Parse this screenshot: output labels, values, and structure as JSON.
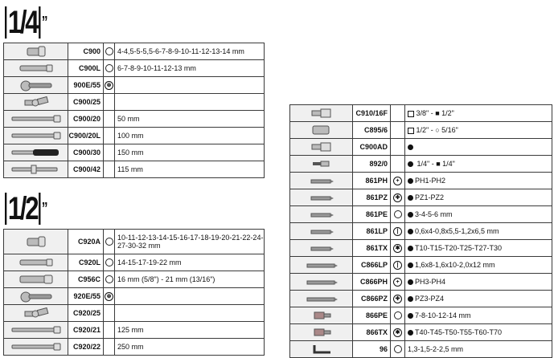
{
  "heading_quarter": {
    "main": "1/4",
    "mark": "”"
  },
  "heading_half": {
    "main": "1/2",
    "mark": "”"
  },
  "table_quarter": [
    {
      "code": "C900",
      "sym": "hex-outline",
      "desc": "4-4,5-5-5,5-6-7-8-9-10-11-12-13-14 mm",
      "icon": "socket-icon"
    },
    {
      "code": "C900L",
      "sym": "hex-outline",
      "desc": "6-7-8-9-10-11-12-13 mm",
      "icon": "deep-socket-icon"
    },
    {
      "code": "900E/55",
      "sym": "ratchet-symbol",
      "desc": "",
      "icon": "ratchet-icon"
    },
    {
      "code": "C900/25",
      "sym": "",
      "desc": "",
      "icon": "universal-joint-icon"
    },
    {
      "code": "C900/20",
      "sym": "",
      "desc": "50 mm",
      "icon": "extension-icon"
    },
    {
      "code": "C900/20L",
      "sym": "",
      "desc": "100 mm",
      "icon": "extension-icon"
    },
    {
      "code": "C900/30",
      "sym": "",
      "desc": "150 mm",
      "icon": "spinner-handle-icon"
    },
    {
      "code": "C900/42",
      "sym": "",
      "desc": "115 mm",
      "icon": "t-bar-icon"
    }
  ],
  "table_half": [
    {
      "code": "C920A",
      "sym": "hex-outline",
      "desc": "10-11-12-13-14-15-16-17-18-19-20-21-22-24-27-30-32 mm",
      "icon": "socket-icon"
    },
    {
      "code": "C920L",
      "sym": "hex-outline",
      "desc": "14-15-17-19-22 mm",
      "icon": "deep-socket-icon"
    },
    {
      "code": "C956C",
      "sym": "hex-outline",
      "desc": "16 mm (5/8\") - 21 mm (13/16\")",
      "icon": "spark-plug-socket-icon"
    },
    {
      "code": "920E/55",
      "sym": "ratchet-symbol",
      "desc": "",
      "icon": "ratchet-icon"
    },
    {
      "code": "C920/25",
      "sym": "",
      "desc": "",
      "icon": "universal-joint-icon"
    },
    {
      "code": "C920/21",
      "sym": "",
      "desc": "125 mm",
      "icon": "extension-icon"
    },
    {
      "code": "C920/22",
      "sym": "",
      "desc": "250 mm",
      "icon": "extension-icon"
    }
  ],
  "table_bits": [
    {
      "code": "C910/16F",
      "sym": "",
      "desc": "3/8\" - ■ 1/2\"",
      "prefix": "square-outline",
      "icon": "adapter-icon"
    },
    {
      "code": "C895/6",
      "sym": "",
      "desc": "1/2\" - ○ 5/16\"",
      "prefix": "square-outline",
      "icon": "bit-holder-icon"
    },
    {
      "code": "C900AD",
      "sym": "",
      "desc": "",
      "prefix": "dot",
      "icon": "adapter-icon"
    },
    {
      "code": "892/0",
      "sym": "",
      "desc": "1/4\" - ■ 1/4\"",
      "prefix": "hex-filled",
      "icon": "bit-adapter-icon"
    },
    {
      "code": "861PH",
      "sym": "phillips",
      "desc": "PH1-PH2",
      "prefix": "dot",
      "icon": "bit-icon"
    },
    {
      "code": "861PZ",
      "sym": "pozidriv",
      "desc": "PZ1-PZ2",
      "prefix": "dot",
      "icon": "bit-icon"
    },
    {
      "code": "861PE",
      "sym": "hex-outline",
      "desc": "3-4-5-6 mm",
      "prefix": "dot",
      "icon": "bit-icon"
    },
    {
      "code": "861LP",
      "sym": "slotted",
      "desc": "0,6x4-0,8x5,5-1,2x6,5 mm",
      "prefix": "dot",
      "icon": "bit-icon"
    },
    {
      "code": "861TX",
      "sym": "torx",
      "desc": "T10-T15-T20-T25-T27-T30",
      "prefix": "dot",
      "icon": "bit-icon"
    },
    {
      "code": "C866LP",
      "sym": "slotted",
      "desc": "1,6x8-1,6x10-2,0x12 mm",
      "prefix": "dot",
      "icon": "long-bit-icon"
    },
    {
      "code": "C866PH",
      "sym": "phillips",
      "desc": "PH3-PH4",
      "prefix": "dot",
      "icon": "long-bit-icon"
    },
    {
      "code": "C866PZ",
      "sym": "pozidriv",
      "desc": "PZ3-PZ4",
      "prefix": "dot",
      "icon": "long-bit-icon"
    },
    {
      "code": "866PE",
      "sym": "hex-outline",
      "desc": "7-8-10-12-14 mm",
      "prefix": "dot",
      "icon": "hex-bit-socket-icon"
    },
    {
      "code": "866TX",
      "sym": "torx",
      "desc": "T40-T45-T50-T55-T60-T70",
      "prefix": "dot",
      "icon": "torx-bit-socket-icon"
    },
    {
      "code": "96",
      "sym": "hex-outline",
      "desc": "1,3-1,5-2-2,5 mm",
      "prefix": "",
      "icon": "hex-key-icon"
    }
  ]
}
